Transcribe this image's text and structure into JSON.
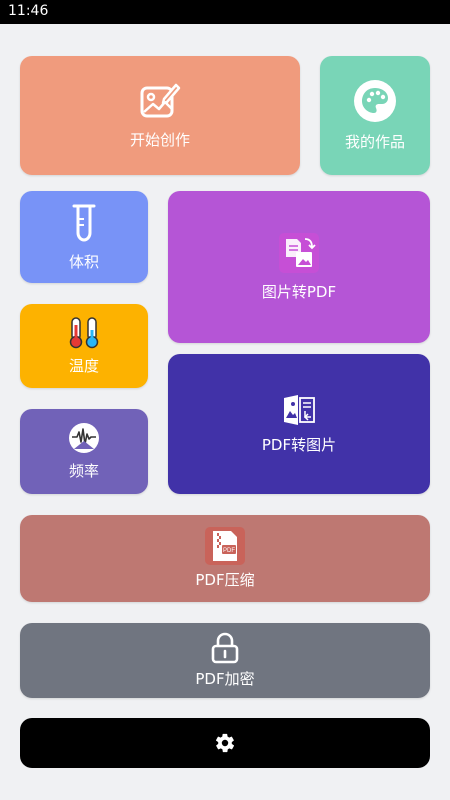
{
  "status_bar": {
    "time": "11:46"
  },
  "tiles": {
    "create": {
      "label": "开始创作",
      "color": "#f09b7d"
    },
    "works": {
      "label": "我的作品",
      "color": "#79d5b7"
    },
    "volume": {
      "label": "体积",
      "color": "#7893f7"
    },
    "img_to_pdf": {
      "label": "图片转PDF",
      "color": "#b555d6"
    },
    "temperature": {
      "label": "温度",
      "color": "#fdb200"
    },
    "frequency": {
      "label": "频率",
      "color": "#7162b8"
    },
    "pdf_to_img": {
      "label": "PDF转图片",
      "color": "#4132a8"
    },
    "pdf_compress": {
      "label": "PDF压缩",
      "color": "#be7872"
    },
    "pdf_encrypt": {
      "label": "PDF加密",
      "color": "#707580"
    },
    "settings": {
      "icon": "gear-icon",
      "color": "#000000"
    }
  },
  "icons": {
    "create": "image-edit-icon",
    "works": "palette-icon",
    "volume": "test-tube-icon",
    "img_to_pdf": "image-to-pdf-icon",
    "temperature": "thermometer-icon",
    "frequency": "frequency-wave-icon",
    "pdf_to_img": "pdf-to-image-icon",
    "pdf_compress": "pdf-compress-icon",
    "pdf_encrypt": "lock-icon"
  }
}
